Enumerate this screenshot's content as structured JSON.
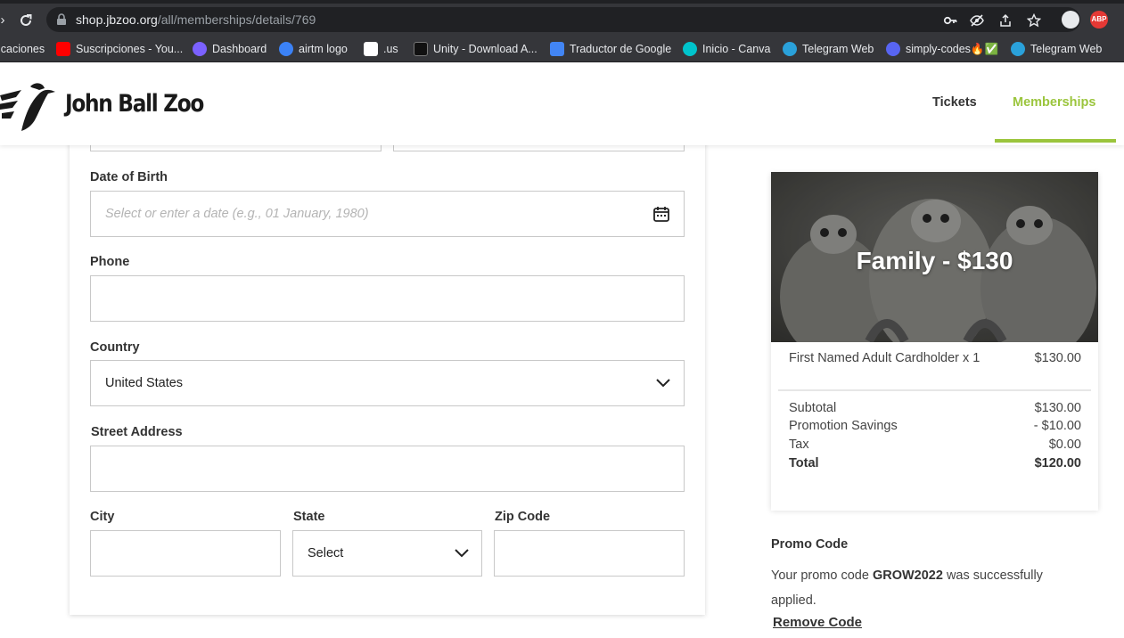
{
  "browser": {
    "url_host": "shop.jbzoo.org",
    "url_path": "/all/memberships/details/769",
    "bookmarks": [
      {
        "label": "icaciones",
        "color": ""
      },
      {
        "label": "Suscripciones - You...",
        "color": "#ff0000"
      },
      {
        "label": "Dashboard",
        "color": "#7b61ff"
      },
      {
        "label": "airtm logo",
        "color": "#3b82f6"
      },
      {
        "label": ".us",
        "color": "#ffffff"
      },
      {
        "label": "Unity - Download A...",
        "color": "#222222"
      },
      {
        "label": "Traductor de Google",
        "color": "#4285f4"
      },
      {
        "label": "Inicio - Canva",
        "color": "#00c4cc"
      },
      {
        "label": "Telegram Web",
        "color": "#2aa1da"
      },
      {
        "label": "simply-codes🔥✅",
        "color": "#5865f2"
      },
      {
        "label": "Telegram Web",
        "color": "#2aa1da"
      }
    ]
  },
  "header": {
    "logo_text": "John Ball Zoo",
    "nav": {
      "tickets": "Tickets",
      "memberships": "Memberships"
    },
    "accent_color": "#9bc53d"
  },
  "form": {
    "dob": {
      "label": "Date of Birth",
      "placeholder": "Select or enter a date (e.g., 01 January, 1980)"
    },
    "phone": {
      "label": "Phone",
      "value": ""
    },
    "country": {
      "label": "Country",
      "value": "United States"
    },
    "street": {
      "label": "Street Address",
      "value": ""
    },
    "city": {
      "label": "City",
      "value": ""
    },
    "state": {
      "label": "State",
      "value": "Select"
    },
    "zip": {
      "label": "Zip Code",
      "value": ""
    }
  },
  "summary": {
    "title": "Family - $130",
    "line_item": {
      "name": "First Named Adult Cardholder x 1",
      "amount": "$130.00"
    },
    "subtotal": {
      "label": "Subtotal",
      "amount": "$130.00"
    },
    "promotion": {
      "label": "Promotion Savings",
      "amount": "- $10.00"
    },
    "tax": {
      "label": "Tax",
      "amount": "$0.00"
    },
    "total": {
      "label": "Total",
      "amount": "$120.00"
    }
  },
  "promo": {
    "title": "Promo Code",
    "text_before": "Your promo code ",
    "code": "GROW2022",
    "text_after": " was successfully applied.",
    "remove_label": "Remove Code"
  }
}
